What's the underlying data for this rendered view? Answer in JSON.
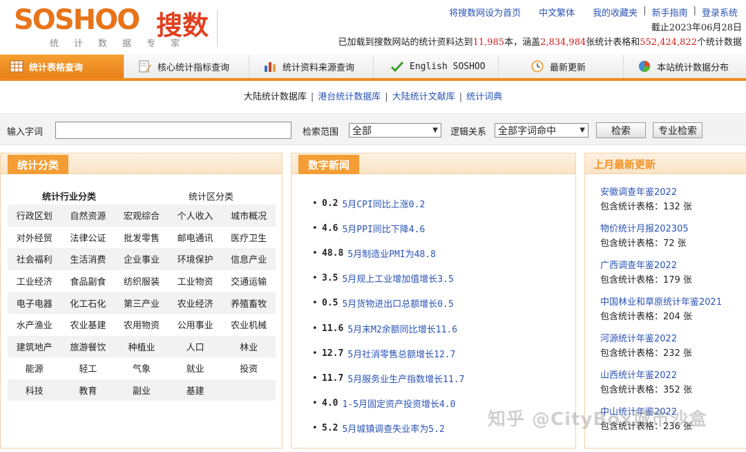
{
  "logo": {
    "brand": "SOSHOO",
    "brand_cn": "搜数",
    "subtitle": "统计数据专家"
  },
  "toplinks": [
    "将搜数网设为首页",
    "中文繁体",
    "我的收藏夹",
    "新手指南",
    "登录系统"
  ],
  "header": {
    "date_line": "截止2023年06月28日",
    "stats_prefix": "已加载到搜数网站的统计资料达到",
    "stats_num1": "11,985",
    "stats_mid1": "本，涵盖",
    "stats_num2": "2,834,984",
    "stats_mid2": "张统计表格和",
    "stats_num3": "552,424,822",
    "stats_suffix": "个统计数据"
  },
  "nav": [
    {
      "label": "统计表格查询",
      "icon": "table-icon",
      "color": "#ffffff"
    },
    {
      "label": "核心统计指标查询",
      "icon": "document-edit-icon",
      "color": "#d9a033"
    },
    {
      "label": "统计资料来源查询",
      "icon": "bar-chart-icon",
      "color": "#c2452f"
    },
    {
      "label": "English SOSHOO",
      "icon": "checkmark-icon",
      "color": "#3a9a24"
    },
    {
      "label": "最新更新",
      "icon": "clock-icon",
      "color": "#e9a237"
    },
    {
      "label": "本站统计数据分布",
      "icon": "pie-chart-icon",
      "color": "#3a8fd6"
    }
  ],
  "subnav": [
    "大陆统计数据库",
    "港台统计数据库",
    "大陆统计文献库",
    "统计词典"
  ],
  "search": {
    "keyword_label": "输入字词",
    "keyword_value": "",
    "scope_label": "检索范围",
    "scope_value": "全部",
    "logic_label": "逻辑关系",
    "logic_value": "全部字词命中",
    "search_button": "检索",
    "advanced_button": "专业检索"
  },
  "categories": {
    "title": "统计分类",
    "industry_header": "统计行业分类",
    "region_header": "统计区分类",
    "rows": [
      [
        "行政区划",
        "自然资源",
        "宏观综合",
        "个人收入",
        "城市概况"
      ],
      [
        "对外经贸",
        "法律公证",
        "批发零售",
        "邮电通讯",
        "医疗卫生"
      ],
      [
        "社会福利",
        "生活消费",
        "企业事业",
        "环境保护",
        "信息产业"
      ],
      [
        "工业经济",
        "食品副食",
        "纺织服装",
        "工业物资",
        "交通运输"
      ],
      [
        "电子电器",
        "化工石化",
        "第三产业",
        "农业经济",
        "养殖畜牧"
      ],
      [
        "水产渔业",
        "农业基建",
        "农用物资",
        "公用事业",
        "农业机械"
      ],
      [
        "建筑地产",
        "旅游餐饮",
        "种植业",
        "人口",
        "林业"
      ],
      [
        "能源",
        "轻工",
        "气象",
        "就业",
        "投资"
      ],
      [
        "科技",
        "教育",
        "副业",
        "基建",
        ""
      ]
    ]
  },
  "news": {
    "title": "数字新闻",
    "items": [
      {
        "value": "0.2",
        "text": "5月CPI同比上涨0.2"
      },
      {
        "value": "4.6",
        "text": "5月PPI同比下降4.6"
      },
      {
        "value": "48.8",
        "text": "5月制造业PMI为48.8"
      },
      {
        "value": "3.5",
        "text": "5月规上工业增加值增长3.5"
      },
      {
        "value": "0.5",
        "text": "5月货物进出口总额增长0.5"
      },
      {
        "value": "11.6",
        "text": "5月末M2余额同比增长11.6"
      },
      {
        "value": "12.7",
        "text": "5月社消零售总额增长12.7"
      },
      {
        "value": "11.7",
        "text": "5月服务业生产指数增长11.7"
      },
      {
        "value": "4.0",
        "text": "1-5月固定资产投资增长4.0"
      },
      {
        "value": "5.2",
        "text": "5月城镇调查失业率为5.2"
      }
    ]
  },
  "updates": {
    "title": "上月最新更新",
    "items": [
      {
        "title": "安徽调查年鉴2022",
        "count": "包含统计表格：132 张"
      },
      {
        "title": "物价统计月报202305",
        "count": "包含统计表格：72 张"
      },
      {
        "title": "广西调查年鉴2022",
        "count": "包含统计表格：179 张"
      },
      {
        "title": "中国林业和草原统计年鉴2021",
        "count": "包含统计表格：204 张"
      },
      {
        "title": "河源统计年鉴2022",
        "count": "包含统计表格：232 张"
      },
      {
        "title": "山西统计年鉴2022",
        "count": "包含统计表格：352 张"
      },
      {
        "title": "中山统计年鉴2022",
        "count": "包含统计表格：236 张"
      }
    ]
  },
  "watermark": "知乎 @CityBox城市沙盒"
}
